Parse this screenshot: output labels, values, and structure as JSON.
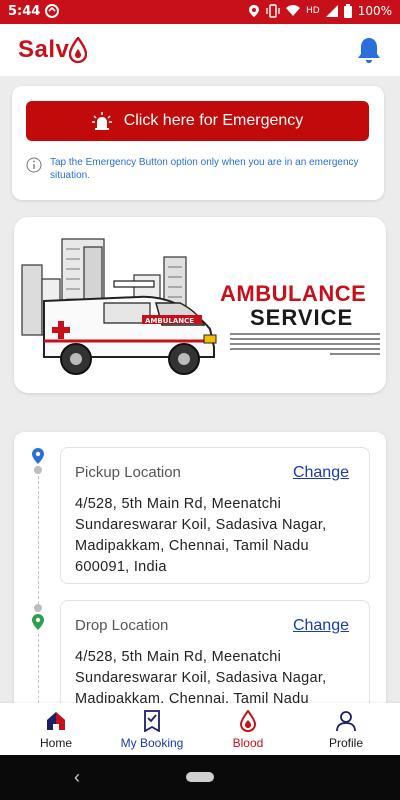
{
  "status_bar": {
    "time": "5:44",
    "network": "HD",
    "battery": "100%"
  },
  "app": {
    "logo_text": "Salv",
    "brand_color": "#c8101a"
  },
  "emergency": {
    "button_label": "Click here for Emergency",
    "note": "Tap the Emergency Button option only when you are in an emergency situation."
  },
  "banner": {
    "title": "AMBULANCE",
    "subtitle": "SERVICE",
    "vehicle_label": "AMBULANCE"
  },
  "locations": {
    "pickup": {
      "label": "Pickup Location",
      "change_label": "Change",
      "address": "4/528, 5th Main Rd, Meenatchi Sundareswarar Koil, Sadasiva Nagar, Madipakkam, Chennai, Tamil Nadu 600091, India"
    },
    "drop": {
      "label": "Drop Location",
      "change_label": "Change",
      "address": "4/528, 5th Main Rd, Meenatchi Sundareswarar Koil, Sadasiva Nagar, Madipakkam, Chennai, Tamil Nadu"
    }
  },
  "bottom_nav": {
    "items": [
      {
        "label": "Home",
        "icon": "home-icon",
        "color": "#1a1a1a"
      },
      {
        "label": "My Booking",
        "icon": "booking-icon",
        "color": "#1a3bb3"
      },
      {
        "label": "Blood",
        "icon": "blood-drop-icon",
        "color": "#c8101a"
      },
      {
        "label": "Profile",
        "icon": "profile-icon",
        "color": "#1a1a1a"
      }
    ]
  }
}
